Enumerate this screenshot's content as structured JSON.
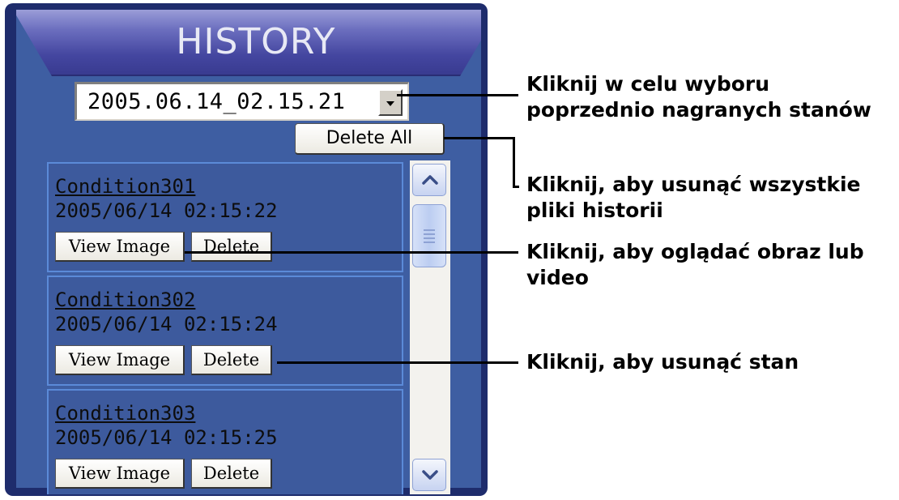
{
  "panel": {
    "title": "HISTORY",
    "date_select": {
      "value": "2005.06.14_02.15.21"
    },
    "delete_all_label": "Delete All",
    "items": [
      {
        "name": "Condition301",
        "datetime": "2005/06/14 02:15:22",
        "view_label": "View Image",
        "delete_label": "Delete"
      },
      {
        "name": "Condition302",
        "datetime": "2005/06/14 02:15:24",
        "view_label": "View Image",
        "delete_label": "Delete"
      },
      {
        "name": "Condition303",
        "datetime": "2005/06/14 02:15:25",
        "view_label": "View Image",
        "delete_label": "Delete"
      }
    ],
    "icons": {
      "dropdown": "chevron-down-icon",
      "scroll_up": "chevron-up-icon",
      "scroll_down": "chevron-down-icon",
      "thumb_grip": "grip-icon"
    }
  },
  "callouts": {
    "select": [
      "Kliknij w celu wyboru",
      "poprzednio nagranych stanów"
    ],
    "delete_all": [
      "Kliknij, aby usunąć wszystkie",
      "pliki historii"
    ],
    "view": [
      "Kliknij, aby oglądać obraz lub",
      "video"
    ],
    "delete": [
      "Kliknij, aby usunąć stan"
    ]
  },
  "colors": {
    "frame": "#1e2c6c",
    "panel": "#3e5ea2",
    "header": "#4446a0",
    "item_border": "#5b8ad8"
  }
}
